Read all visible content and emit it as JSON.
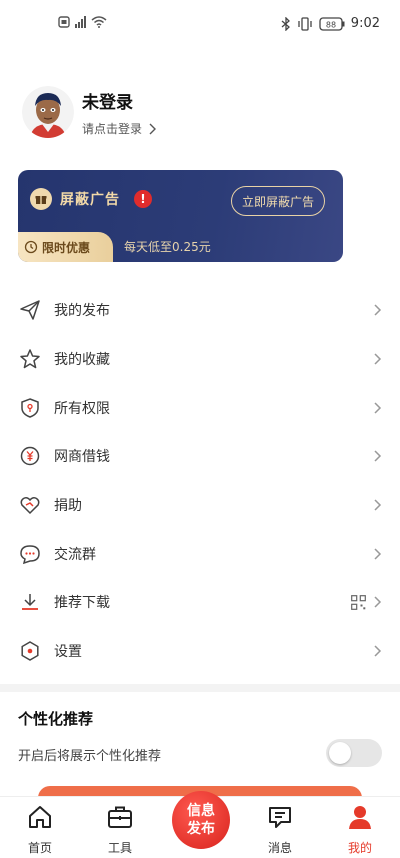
{
  "status_bar": {
    "time": "9:02",
    "battery": "88"
  },
  "profile": {
    "name": "未登录",
    "subtitle": "请点击登录",
    "subtitle_arrow": ">"
  },
  "ad_banner": {
    "title": "屏蔽广告",
    "warning": "!",
    "button": "立即屏蔽广告",
    "badge": "限时优惠",
    "price_text": "每天低至0.25元"
  },
  "menu": {
    "items": [
      {
        "label": "我的发布",
        "icon": "send-icon"
      },
      {
        "label": "我的收藏",
        "icon": "star-icon"
      },
      {
        "label": "所有权限",
        "icon": "shield-icon"
      },
      {
        "label": "网商借钱",
        "icon": "yuan-icon"
      },
      {
        "label": "捐助",
        "icon": "heart-icon"
      },
      {
        "label": "交流群",
        "icon": "chat-icon"
      },
      {
        "label": "推荐下载",
        "icon": "download-icon"
      },
      {
        "label": "设置",
        "icon": "settings-icon"
      }
    ]
  },
  "personalized": {
    "title": "个性化推荐",
    "description": "开启后将展示个性化推荐",
    "enabled": false
  },
  "bottom_nav": {
    "home": "首页",
    "tools": "工具",
    "publish_line1": "信息",
    "publish_line2": "发布",
    "messages": "消息",
    "mine": "我的"
  },
  "colors": {
    "accent": "#e53a2a",
    "banner": "#2c3c77",
    "gold": "#f2d9a8"
  }
}
